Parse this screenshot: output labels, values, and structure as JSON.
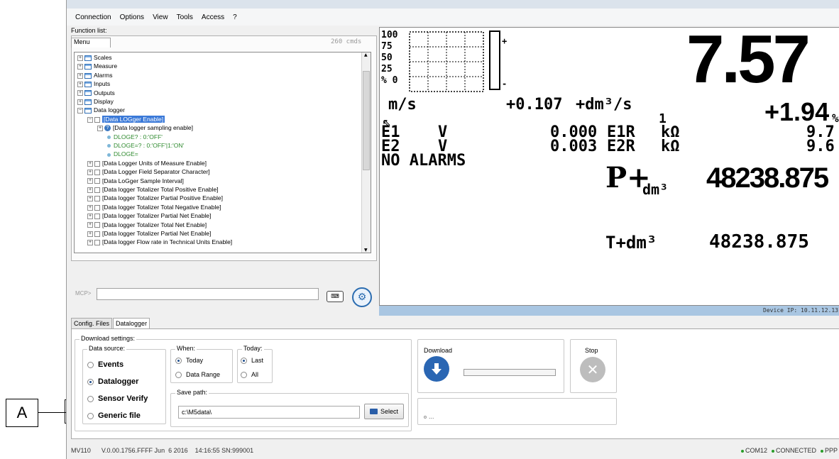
{
  "callout": {
    "label": "A"
  },
  "menubar": [
    "Connection",
    "Options",
    "View",
    "Tools",
    "Access",
    "?"
  ],
  "function_list": {
    "label": "Function list:",
    "tab": "Menu",
    "count": "260 cmds",
    "tree": [
      {
        "text": "Scales",
        "kind": "group"
      },
      {
        "text": "Measure",
        "kind": "group"
      },
      {
        "text": "Alarms",
        "kind": "group"
      },
      {
        "text": "Inputs",
        "kind": "group"
      },
      {
        "text": "Outputs",
        "kind": "group"
      },
      {
        "text": "Display",
        "kind": "group"
      },
      {
        "text": "Data logger",
        "kind": "group-open"
      },
      {
        "text": "[Data LOGger Enable]",
        "kind": "selected"
      },
      {
        "text": "[Data logger sampling enable]",
        "kind": "info"
      },
      {
        "text": "DLOGE? : 0:'OFF'",
        "kind": "green"
      },
      {
        "text": "DLOGE=? : 0:'OFF'|1:'ON'",
        "kind": "green"
      },
      {
        "text": "DLOGE=",
        "kind": "green"
      },
      {
        "text": "[Data Logger Units of Measure Enable]",
        "kind": "item"
      },
      {
        "text": "[Data Logger Field Separator Character]",
        "kind": "item"
      },
      {
        "text": "[Data LoGger Sample Interval]",
        "kind": "item"
      },
      {
        "text": "[Data logger Totalizer Total Positive Enable]",
        "kind": "item"
      },
      {
        "text": "[Data logger Totalizer Partial Positive Enable]",
        "kind": "item"
      },
      {
        "text": "[Data logger Totalizer Total Negative Enable]",
        "kind": "item"
      },
      {
        "text": "[Data logger Totalizer Partial Net Enable]",
        "kind": "item"
      },
      {
        "text": "[Data logger Totalizer Total Net Enable]",
        "kind": "item"
      },
      {
        "text": "[Data logger Totalizer Partial Net Enable]",
        "kind": "item"
      },
      {
        "text": "[Data logger Flow rate in Technical Units Enable]",
        "kind": "item"
      }
    ],
    "mcp_label": "MCP>"
  },
  "display": {
    "axis": [
      "100",
      "75",
      "50",
      "25",
      "% 0"
    ],
    "big_value": "7.57",
    "unit_left": "m/s",
    "flow_value": "+0.107",
    "flow_unit": "+dm³/s",
    "percent": "+1.94",
    "percent_sign": "%",
    "one": "1",
    "e1": "E1",
    "e1_v": "V",
    "e1_val": "0.000",
    "e1r": "E1R",
    "e1r_unit": "kΩ",
    "e1r_val": "9.7",
    "e2": "E2",
    "e2_v": "V",
    "e2_val": "0.003",
    "e2r": "E2R",
    "e2r_unit": "kΩ",
    "e2r_val": "9.6",
    "alarms": "NO ALARMS",
    "ptot_label": "P+",
    "ptot_unit": "dm³",
    "ptot_val": "48238.875",
    "ttot_label": "T+dm³",
    "ttot_val": "48238.875",
    "device_ip": "Device IP: 10.11.12.13"
  },
  "lower": {
    "tabs": [
      "Config. Files",
      "Datalogger"
    ],
    "download_settings": "Download settings:",
    "data_source_title": "Data source:",
    "data_source": [
      "Events",
      "Datalogger",
      "Sensor Verify",
      "Generic file"
    ],
    "data_source_selected": "Datalogger",
    "when_title": "When:",
    "when": [
      "Today",
      "Data Range"
    ],
    "when_selected": "Today",
    "today_title": "Today:",
    "today": [
      "Last",
      "All"
    ],
    "today_selected": "Last",
    "save_path_title": "Save path:",
    "save_path": "c:\\M5data\\",
    "select_label": "Select",
    "download_title": "Download",
    "stop_title": "Stop",
    "log_text": "...",
    "progress": 0
  },
  "statusbar": {
    "left": "MV110      V.0.00.1756.FFFF Jun  6 2016    14:16:55 SN:999001",
    "com": "COM12",
    "connected": "CONNECTED",
    "ppp": "PPP"
  }
}
